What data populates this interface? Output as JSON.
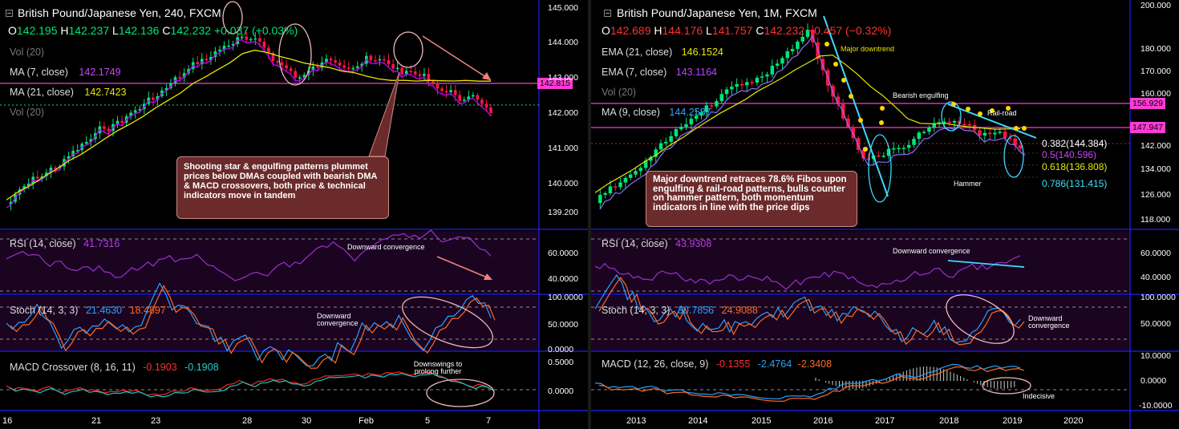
{
  "left": {
    "title": "British Pound/Japanese Yen, 240, FXCM",
    "ohlc": {
      "o_lbl": "O",
      "o": "142.195",
      "h_lbl": "H",
      "h": "142.237",
      "l_lbl": "L",
      "l": "142.136",
      "c_lbl": "C",
      "c": "142.232",
      "chg": "+0.037 (+0.03%)"
    },
    "legend": {
      "vol1": "Vol (20)",
      "ma7_lbl": "MA (7, close)",
      "ma7_val": "142.1749",
      "ma21_lbl": "MA (21, close)",
      "ma21_val": "142.7423",
      "vol2": "Vol (20)"
    },
    "price_tag": "142.815",
    "y_ticks": [
      "145.000",
      "144.000",
      "143.000",
      "142.000",
      "141.000",
      "140.000",
      "139.200"
    ],
    "x_ticks": [
      "16",
      "21",
      "23",
      "28",
      "30",
      "Feb",
      "5",
      "7"
    ],
    "annotation": "Shooting star & engulfing patterns plummet prices below DMAs coupled with bearish DMA & MACD crossovers, both price & technical indicators move in tandem",
    "rsi": {
      "lbl": "RSI (14, close)",
      "val": "41.7316",
      "ticks": [
        "60.0000",
        "40.0000"
      ],
      "note": "Downward convergence"
    },
    "stoch": {
      "lbl": "Stoch (14, 3, 3)",
      "k": "21.4630",
      "d": "18.4897",
      "ticks": [
        "100.0000",
        "50.0000",
        "0.0000"
      ],
      "note": "Downward convergence"
    },
    "macd": {
      "lbl": "MACD Crossover (8, 16, 11)",
      "v1": "-0.1903",
      "v2": "-0.1908",
      "ticks": [
        "0.5000",
        "0.0000"
      ],
      "note": "Downswings to prolong further"
    }
  },
  "right": {
    "title": "British Pound/Japanese Yen, 1M, FXCM",
    "ohlc": {
      "o_lbl": "O",
      "o": "142.689",
      "h_lbl": "H",
      "h": "144.176",
      "l_lbl": "L",
      "l": "141.757",
      "c_lbl": "C",
      "c": "142.232",
      "chg": "−0.457 (−0.32%)"
    },
    "legend": {
      "ema21_lbl": "EMA (21, close)",
      "ema21_val": "146.1524",
      "ema7_lbl": "EMA (7, close)",
      "ema7_val": "143.1164",
      "vol": "Vol (20)",
      "ma9_lbl": "MA (9, close)",
      "ma9_val": "144.2587"
    },
    "price_tags": [
      "156.929",
      "147.947"
    ],
    "y_ticks": [
      "200.000",
      "180.000",
      "170.000",
      "160.000",
      "142.000",
      "134.000",
      "126.000",
      "118.000"
    ],
    "x_ticks": [
      "2013",
      "2014",
      "2015",
      "2016",
      "2017",
      "2018",
      "2019",
      "2020"
    ],
    "fibs": [
      "0.382(144.384)",
      "0.5(140.596)",
      "0.618(136.808)",
      "0.786(131.415)"
    ],
    "labels": {
      "major": "Major downtrend",
      "bearish": "Bearish engulfing",
      "railroad": "Rail-road",
      "hammer": "Hammer"
    },
    "annotation": "Major downtrend retraces 78.6% Fibos upon engulfing & rail-road patterns, bulls counter on hammer pattern, both momentum indicators in line with the price dips",
    "rsi": {
      "lbl": "RSI (14, close)",
      "val": "43.9308",
      "ticks": [
        "60.0000",
        "40.0000"
      ],
      "note": "Downward convergence"
    },
    "stoch": {
      "lbl": "Stoch (14, 3, 3)",
      "k": "30.7856",
      "d": "24.9088",
      "ticks": [
        "100.0000",
        "50.0000"
      ],
      "note": "Downward convergence"
    },
    "macd": {
      "lbl": "MACD (12, 26, close, 9)",
      "v1": "-0.1355",
      "v2": "-2.4764",
      "v3": "-2.3408",
      "ticks": [
        "10.0000",
        "0.0000",
        "-10.0000"
      ],
      "note": "Indecisive"
    }
  },
  "colors": {
    "up": "#00e676",
    "down": "#ff1744",
    "ma_fast": "#c000ff",
    "ma_slow": "#e8e800",
    "pane_bg": "#1a0420",
    "sep": "#1f1fff",
    "tag_pink": "#ff3bd6",
    "note_bg": "#6b2b2b"
  }
}
